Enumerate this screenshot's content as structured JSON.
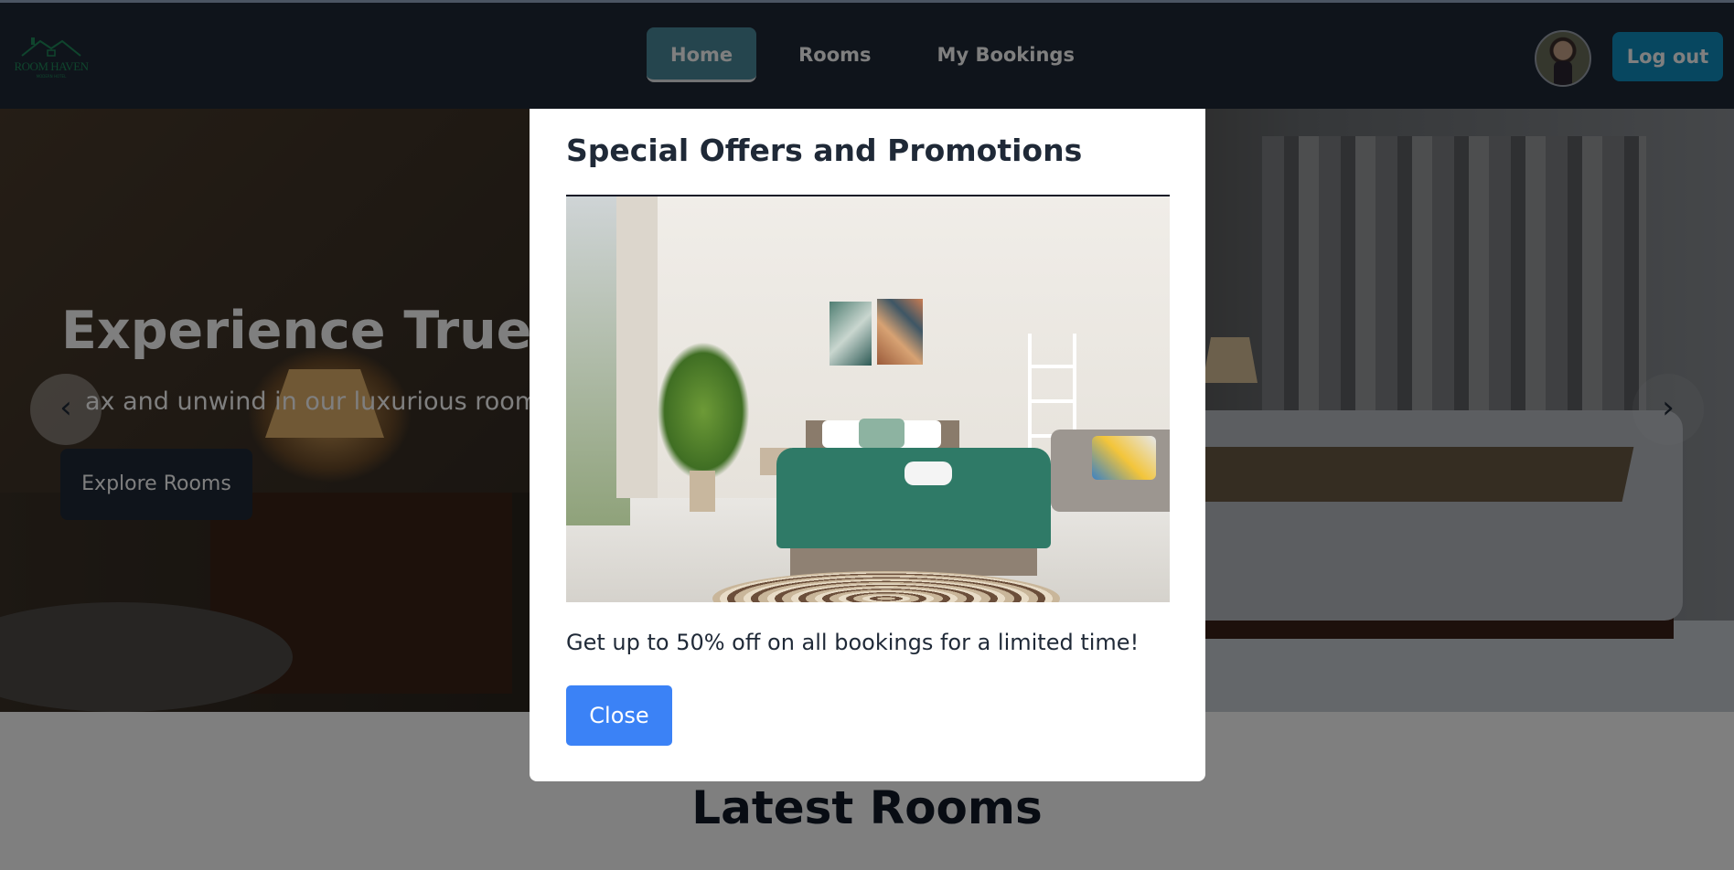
{
  "navbar": {
    "logo_text": "ROOM HAVEN",
    "logo_subtext": "MODERN HOTEL",
    "links": [
      {
        "label": "Home",
        "active": true
      },
      {
        "label": "Rooms",
        "active": false
      },
      {
        "label": "My Bookings",
        "active": false
      }
    ],
    "logout_label": "Log out",
    "avatar_icon": "user-avatar"
  },
  "hero": {
    "title": "Experience True Lu",
    "subtitle": "ax and unwind in our luxurious room",
    "cta_label": "Explore Rooms",
    "prev_arrow": "‹",
    "next_arrow": "›"
  },
  "latest": {
    "title": "Latest Rooms"
  },
  "modal": {
    "title": "Special Offers and Promotions",
    "message": "Get up to 50% off on all bookings for a limited time!",
    "close_label": "Close"
  },
  "colors": {
    "navbar_bg": "#1f2937",
    "active_nav": "#4b8b9c",
    "logout_bg": "#0e8fc0",
    "close_bg": "#3b82f6",
    "overlay": "rgba(0,0,0,0.5)"
  }
}
